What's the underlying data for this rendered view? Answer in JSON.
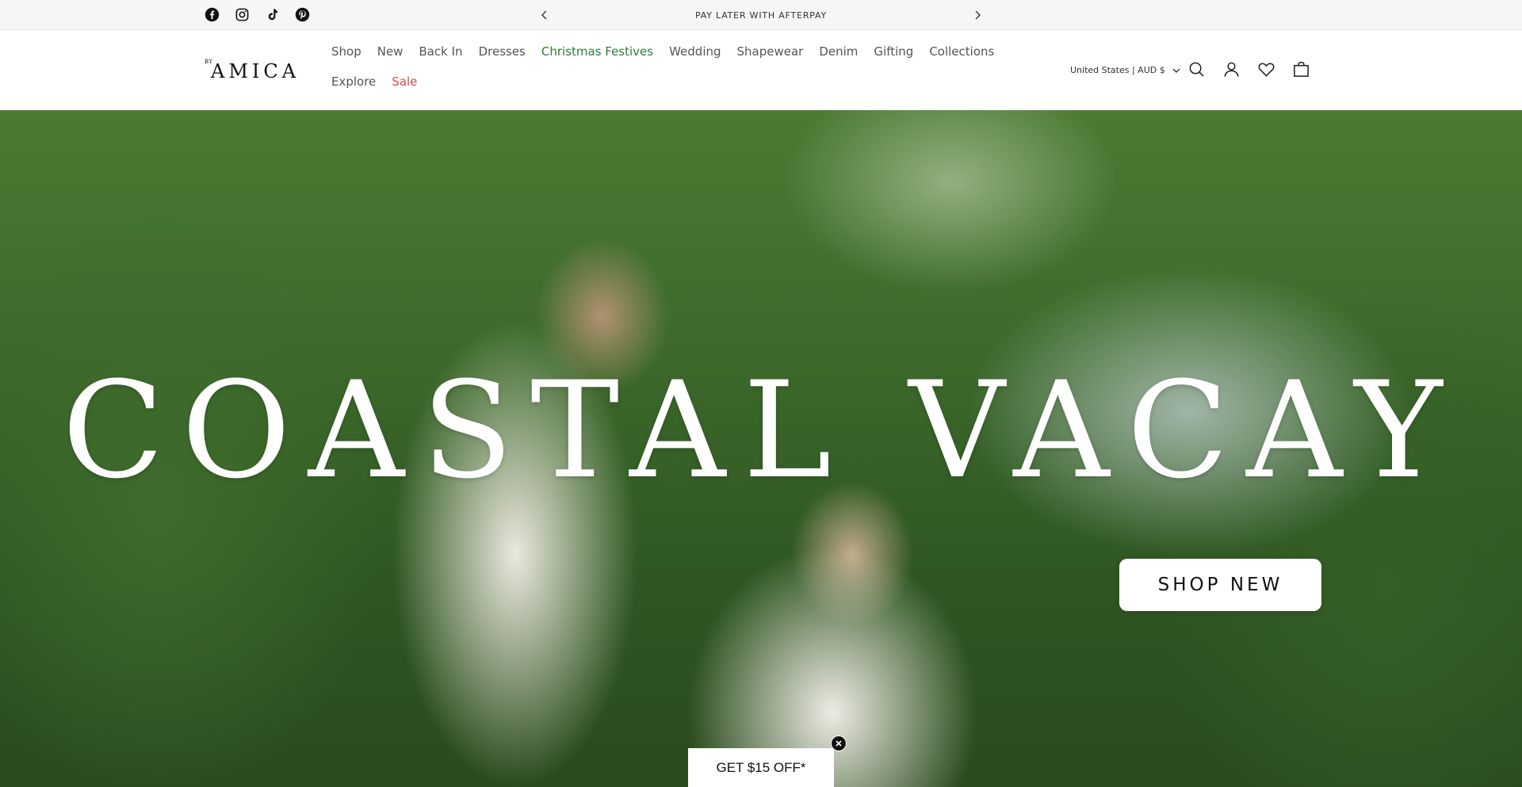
{
  "announcement": {
    "social_icons": [
      "facebook-icon",
      "instagram-icon",
      "tiktok-icon",
      "pinterest-icon"
    ],
    "text": "PAY LATER WITH AFTERPAY",
    "prev_icon": "chevron-left-icon",
    "next_icon": "chevron-right-icon"
  },
  "header": {
    "logo_small": "BY",
    "logo_main": "AMICA",
    "nav": [
      {
        "label": "Shop"
      },
      {
        "label": "New"
      },
      {
        "label": "Back In"
      },
      {
        "label": "Dresses"
      },
      {
        "label": "Christmas Festives",
        "color": "#2f7d37"
      },
      {
        "label": "Wedding"
      },
      {
        "label": "Shapewear"
      },
      {
        "label": "Denim"
      },
      {
        "label": "Gifting"
      },
      {
        "label": "Collections"
      },
      {
        "label": "Explore"
      },
      {
        "label": "Sale",
        "color": "#d64b4b"
      }
    ],
    "country_selector": "United States | AUD $",
    "icons": [
      "search-icon",
      "account-icon",
      "wishlist-heart-icon",
      "cart-bag-icon"
    ]
  },
  "hero": {
    "title": "COASTAL VACAY",
    "button_label": "SHOP NEW"
  },
  "promo": {
    "label": "GET $15 OFF*",
    "close_icon": "close-icon"
  }
}
